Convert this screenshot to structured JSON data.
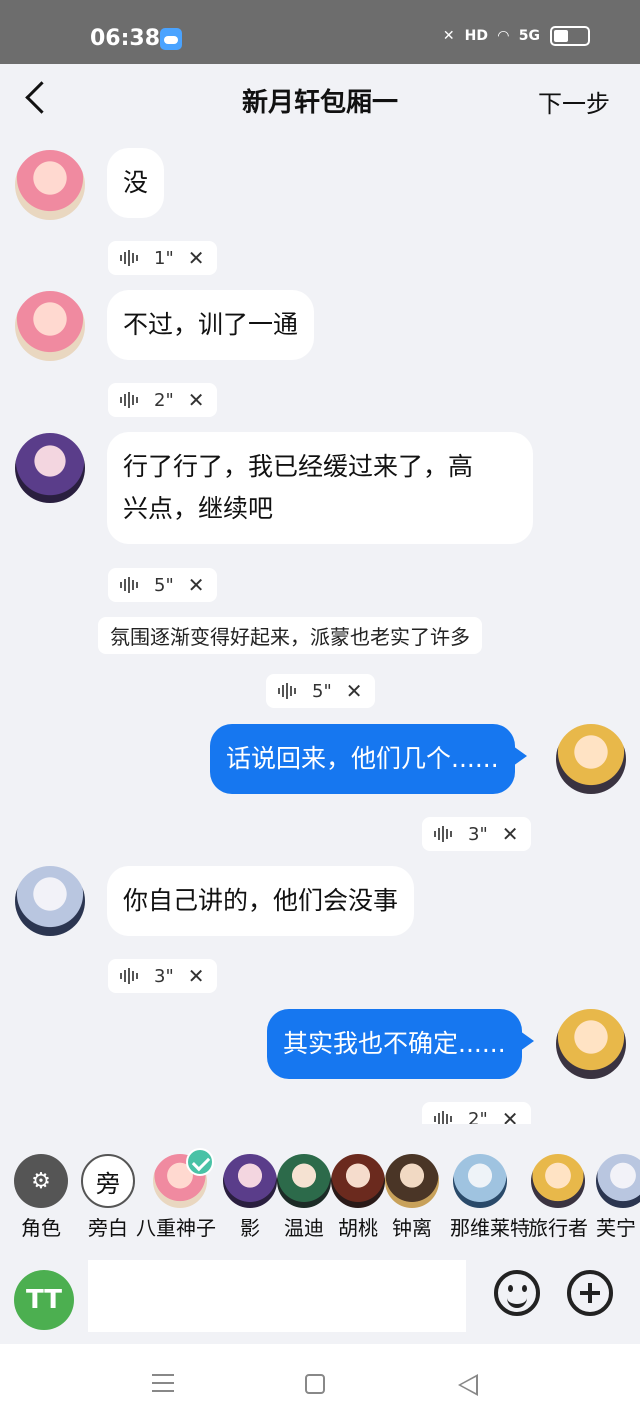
{
  "status": {
    "time": "06:38",
    "net": "HD",
    "signal": "5G"
  },
  "header": {
    "title": "新月轩包厢一",
    "next_label": "下一步"
  },
  "messages": [
    {
      "text": "没",
      "duration": "1\""
    },
    {
      "text": "不过，训了一通",
      "duration": "2\""
    },
    {
      "line1": "行了行了，我已经缓过来了，高",
      "line2": "兴点，继续吧",
      "duration": "5\""
    },
    {
      "text": "氛围逐渐变得好起来，派蒙也老实了许多",
      "duration": "5\""
    },
    {
      "text": "话说回来，他们几个......",
      "duration": "3\""
    },
    {
      "text": "你自己讲的，他们会没事",
      "duration": "3\""
    },
    {
      "text": "其实我也不确定......",
      "duration": "2\""
    }
  ],
  "characters": [
    {
      "label": "角色"
    },
    {
      "label": "旁白",
      "glyph": "旁"
    },
    {
      "label": "八重神子"
    },
    {
      "label": "影"
    },
    {
      "label": "温迪"
    },
    {
      "label": "胡桃"
    },
    {
      "label": "钟离"
    },
    {
      "label": "那维莱特"
    },
    {
      "label": "旅行者"
    },
    {
      "label": "芙宁"
    }
  ],
  "input": {
    "tt_label": "TT",
    "placeholder": ""
  },
  "colors": {
    "outgoing_bubble": "#1677f0",
    "background": "#f1f2f6",
    "tt_button": "#4caf50",
    "selected_check": "#49c2a6"
  }
}
